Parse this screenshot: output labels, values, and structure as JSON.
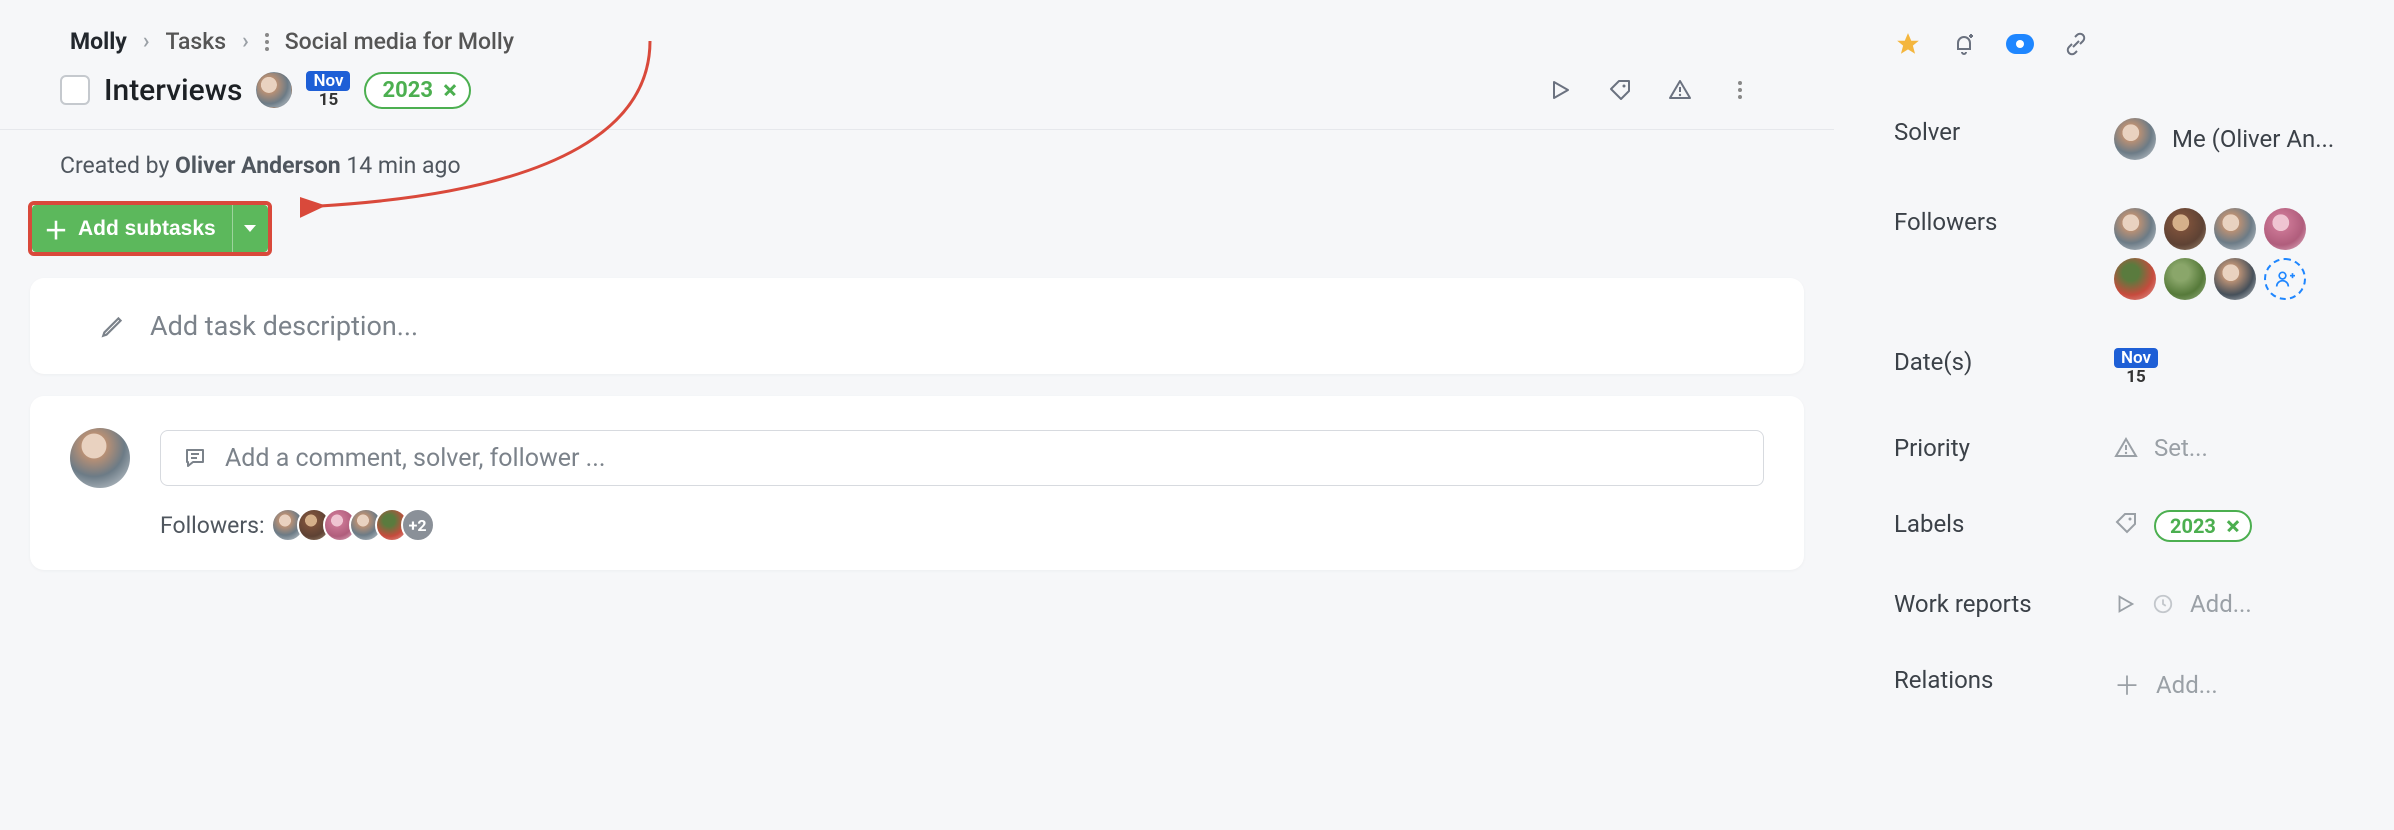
{
  "breadcrumbs": {
    "root": "Molly",
    "mid": "Tasks",
    "leaf": "Social media for Molly"
  },
  "task": {
    "title": "Interviews",
    "date": {
      "month": "Nov",
      "day": "15"
    },
    "year_chip": "2023",
    "created_by_prefix": "Created by ",
    "created_by_name": "Oliver Anderson",
    "created_by_suffix": " 14 min ago"
  },
  "add_subtasks_label": "Add subtasks",
  "description_placeholder": "Add task description...",
  "comment_placeholder": "Add a comment, solver, follower ...",
  "followers_label": "Followers:",
  "followers_overflow": "+2",
  "sidebar": {
    "solver_label": "Solver",
    "solver_value": "Me (Oliver An...",
    "followers_label": "Followers",
    "dates_label": "Date(s)",
    "priority_label": "Priority",
    "priority_value": "Set...",
    "labels_label": "Labels",
    "labels_chip": "2023",
    "work_reports_label": "Work reports",
    "work_reports_value": "Add...",
    "relations_label": "Relations",
    "relations_value": "Add..."
  }
}
